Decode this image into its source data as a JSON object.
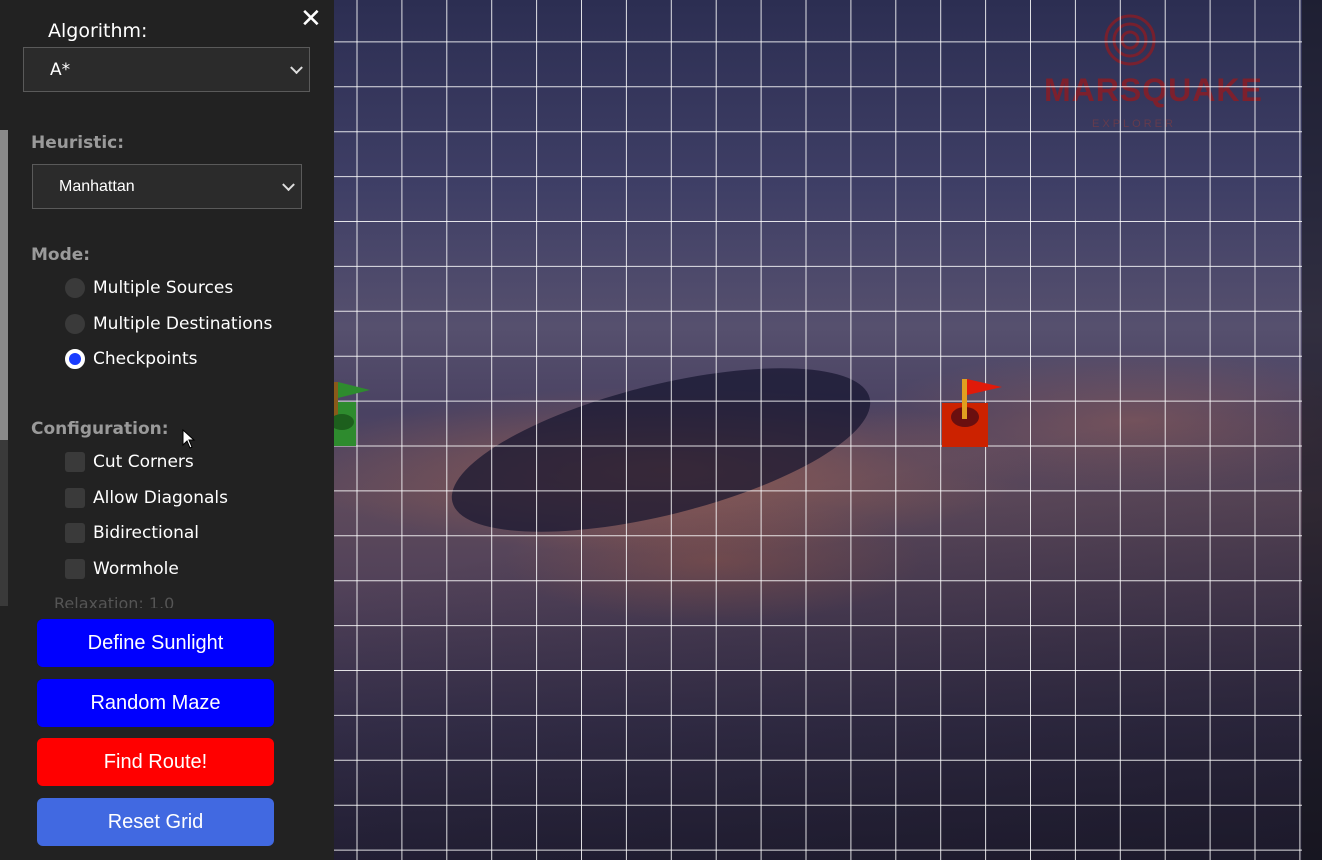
{
  "sidebar": {
    "close_icon": "✕",
    "algorithm": {
      "label": "Algorithm:",
      "selected": "A*"
    },
    "heuristic": {
      "label": "Heuristic:",
      "selected": "Manhattan"
    },
    "mode": {
      "label": "Mode:",
      "options": [
        {
          "label": "Multiple Sources",
          "selected": false
        },
        {
          "label": "Multiple Destinations",
          "selected": false
        },
        {
          "label": "Checkpoints",
          "selected": true
        }
      ]
    },
    "configuration": {
      "label": "Configuration:",
      "options": [
        {
          "label": "Cut Corners",
          "checked": false
        },
        {
          "label": "Allow Diagonals",
          "checked": false
        },
        {
          "label": "Bidirectional",
          "checked": false
        },
        {
          "label": "Wormhole",
          "checked": false
        }
      ]
    },
    "relaxation_label": "Relaxation: 1.0",
    "buttons": {
      "define_sunlight": "Define Sunlight",
      "random_maze": "Random Maze",
      "find_route": "Find Route!",
      "reset_grid": "Reset Grid"
    }
  },
  "logo": {
    "text": "MARSQUAKE",
    "subtext": "EXPLORER"
  },
  "colors": {
    "primary_button": "#0000ff",
    "danger_button": "#ff0000",
    "reset_button": "#4169e1",
    "radio_selected": "#1a3cff",
    "start_marker": "#2e8b2e",
    "destination_marker": "#cc2200"
  }
}
